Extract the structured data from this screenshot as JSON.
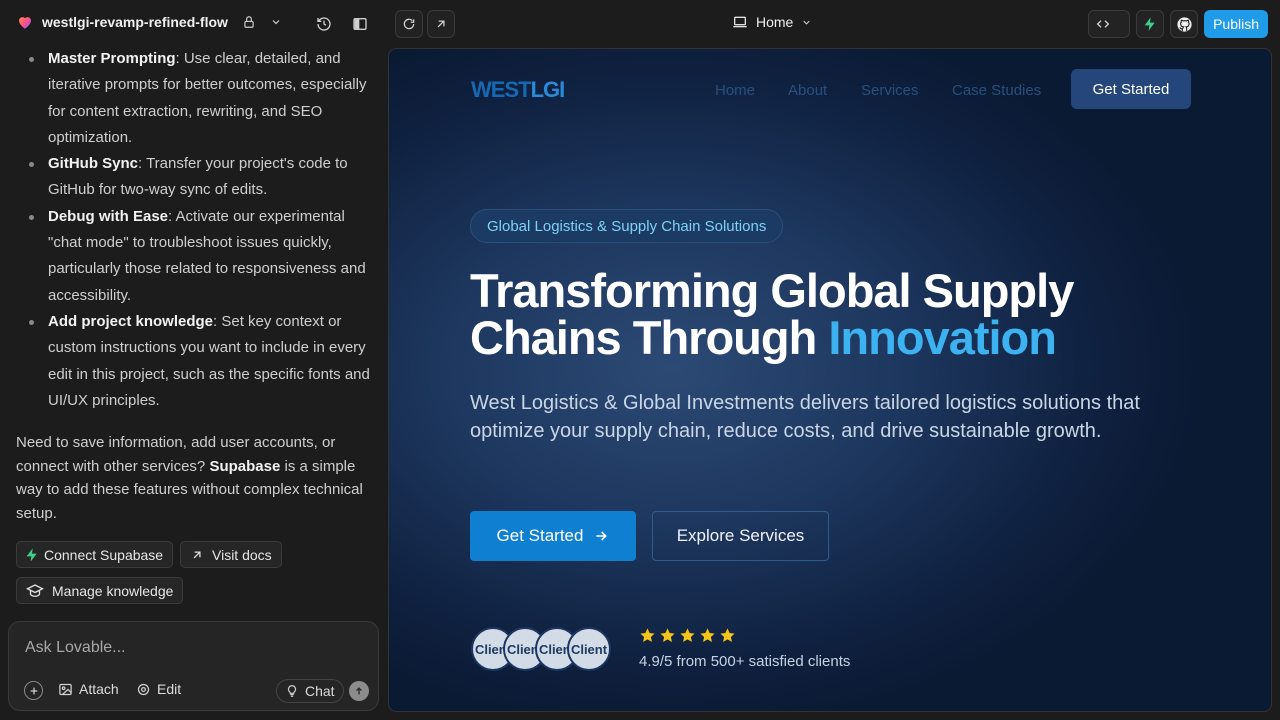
{
  "project": {
    "name": "westlgi-revamp-refined-flow"
  },
  "topbar": {
    "page_selector": "Home",
    "publish_label": "Publish"
  },
  "chat": {
    "tips": [
      {
        "title": "Master Prompting",
        "text": ": Use clear, detailed, and iterative prompts for better outcomes, especially for content extraction, rewriting, and SEO optimization."
      },
      {
        "title": "GitHub Sync",
        "text": ": Transfer your project's code to GitHub for two-way sync of edits."
      },
      {
        "title": "Debug with Ease",
        "text": ": Activate our experimental \"chat mode\" to troubleshoot issues quickly, particularly those related to responsiveness and accessibility."
      },
      {
        "title": "Add project knowledge",
        "text": ": Set key context or custom instructions you want to include in every edit in this project, such as the specific fonts and UI/UX principles."
      }
    ],
    "supabase_pre": "Need to save information, add user accounts, or connect with other services?",
    "supabase_name": "Supabase",
    "supabase_post": "is a simple way to add these features without complex technical setup.",
    "connect_supabase": "Connect Supabase",
    "visit_docs": "Visit docs",
    "manage_knowledge": "Manage knowledge"
  },
  "composer": {
    "placeholder": "Ask Lovable...",
    "attach": "Attach",
    "edit": "Edit",
    "chat": "Chat"
  },
  "site": {
    "logo_a": "WEST",
    "logo_b": "LGI",
    "nav": [
      "Home",
      "About",
      "Services",
      "Case Studies"
    ],
    "nav_cta": "Get Started",
    "tag": "Global Logistics & Supply Chain Solutions",
    "headline_1": "Transforming Global Supply",
    "headline_2": "Chains Through",
    "headline_highlight": "Innovation",
    "subtitle": "West Logistics & Global Investments delivers tailored logistics solutions that optimize your supply chain, reduce costs, and drive sustainable growth.",
    "primary_cta": "Get Started",
    "secondary_cta": "Explore Services",
    "avatars": [
      "Client",
      "Client",
      "Client",
      "Client"
    ],
    "rating_stars": 5,
    "rating_text": "4.9/5 from 500+ satisfied clients"
  },
  "colors": {
    "accent": "#1f9be8",
    "highlight": "#3db2f0",
    "star": "#f5c518",
    "supabase_green": "#3ecf8e"
  }
}
